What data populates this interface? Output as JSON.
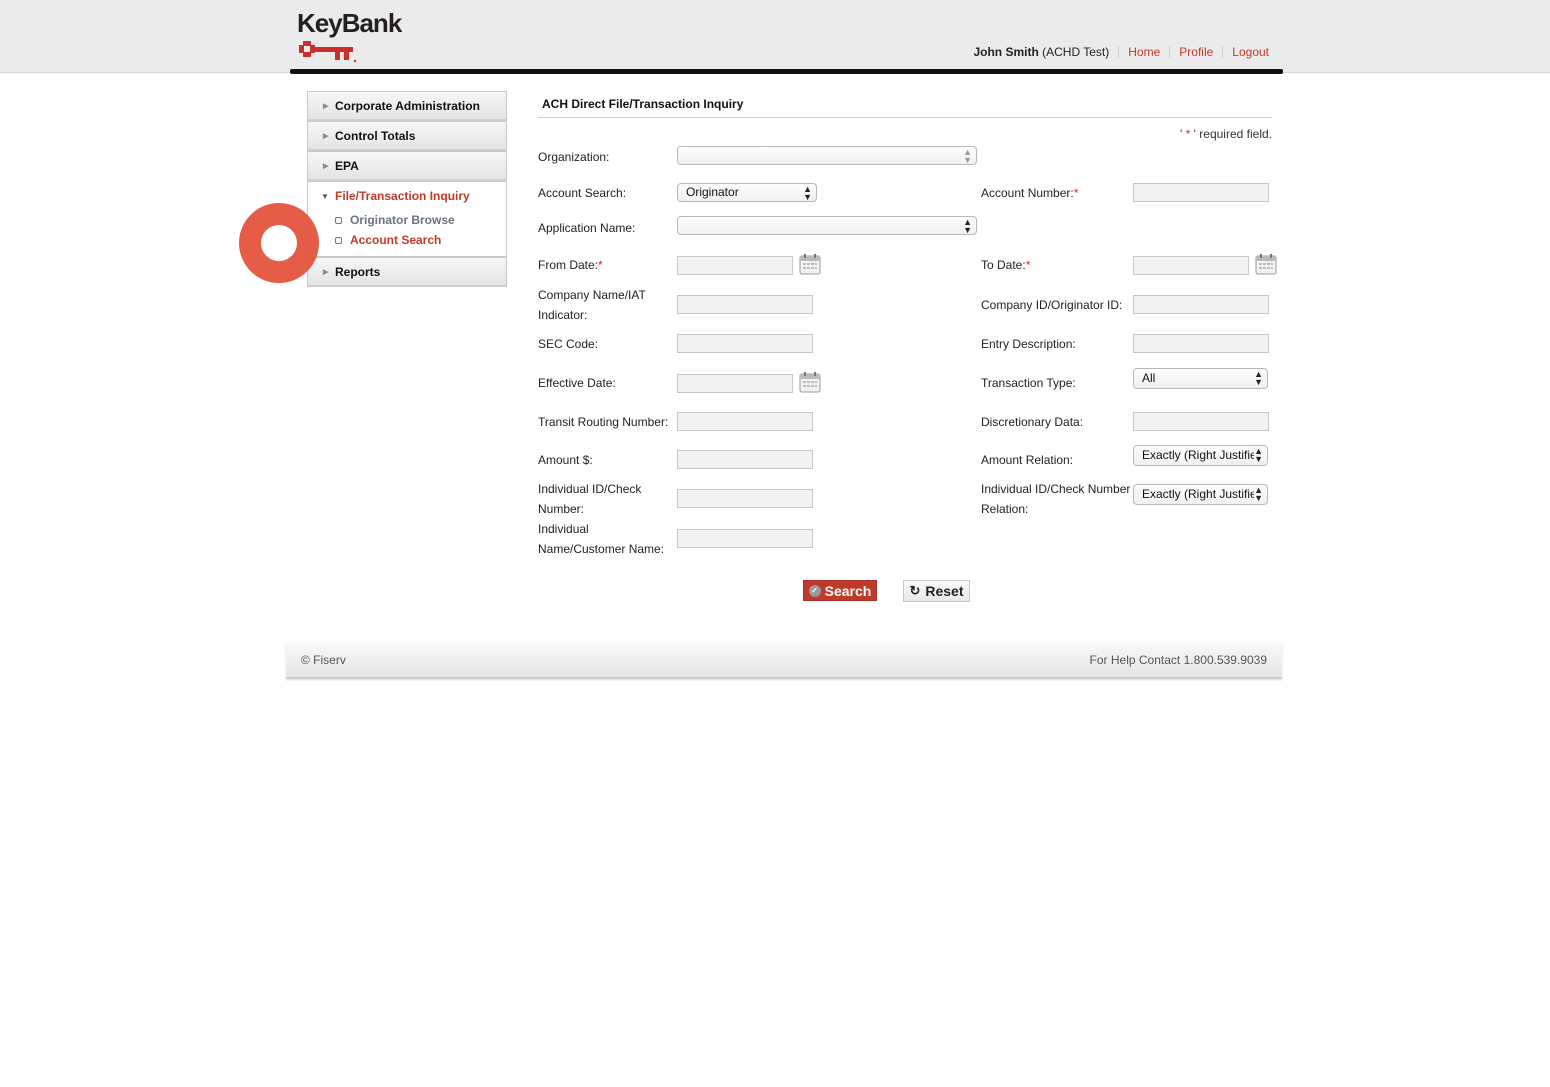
{
  "brand": {
    "name": "KeyBank",
    "accent_color": "#c0392b",
    "logo_icon": "key-icon"
  },
  "user_nav": {
    "user_name": "John Smith",
    "user_role": "(ACHD Test)",
    "links": [
      "Home",
      "Profile",
      "Logout"
    ]
  },
  "sidebar": {
    "items": [
      {
        "label": "Corporate Administration",
        "expanded": false
      },
      {
        "label": "Control Totals",
        "expanded": false
      },
      {
        "label": "EPA",
        "expanded": false
      },
      {
        "label": "File/Transaction Inquiry",
        "expanded": true,
        "children": [
          {
            "label": "Originator Browse"
          },
          {
            "label": "Account Search",
            "active": true
          }
        ]
      },
      {
        "label": "Reports",
        "expanded": false
      }
    ]
  },
  "main": {
    "title": "ACH Direct File/Transaction Inquiry",
    "required_note_pre": "' ",
    "required_star": "*",
    "required_note_post": " ' required field.",
    "fields": {
      "organization": {
        "label": "Organization:",
        "value": ""
      },
      "account_search": {
        "label": "Account Search:",
        "value": "Originator"
      },
      "account_number": {
        "label": "Account Number:",
        "required": true,
        "value": ""
      },
      "application_name": {
        "label": "Application Name:",
        "value": ""
      },
      "from_date": {
        "label": "From Date:",
        "required": true,
        "value": ""
      },
      "to_date": {
        "label": "To Date:",
        "required": true,
        "value": ""
      },
      "company_name_1": {
        "label": "Company Name/IAT"
      },
      "company_name_2": {
        "label": "Indicator:"
      },
      "company_id": {
        "label": "Company ID/Originator ID:",
        "value": ""
      },
      "sec_code": {
        "label": "SEC Code:",
        "value": ""
      },
      "entry_description": {
        "label": "Entry Description:",
        "value": ""
      },
      "effective_date": {
        "label": "Effective Date:",
        "value": ""
      },
      "transaction_type": {
        "label": "Transaction Type:",
        "value": "All"
      },
      "transit_routing": {
        "label": "Transit Routing Number:",
        "value": ""
      },
      "discretionary_data": {
        "label": "Discretionary Data:",
        "value": ""
      },
      "amount": {
        "label": "Amount $:",
        "value": ""
      },
      "amount_relation": {
        "label": "Amount Relation:",
        "value": "Exactly (Right Justifie"
      },
      "indiv_id_1": {
        "label": "Individual ID/Check"
      },
      "indiv_id_2": {
        "label": "Number:"
      },
      "indiv_id_rel_1": {
        "label": "Individual ID/Check Number"
      },
      "indiv_id_rel_2": {
        "label": "Relation:"
      },
      "indiv_id_relation": {
        "value": "Exactly (Right Justifie"
      },
      "indiv_name_1": {
        "label": "Individual"
      },
      "indiv_name_2": {
        "label": "Name/Customer Name:"
      }
    },
    "buttons": {
      "search": "Search",
      "reset": "Reset"
    }
  },
  "footer": {
    "copyright": "© Fiserv",
    "help": "For Help Contact 1.800.539.9039"
  }
}
